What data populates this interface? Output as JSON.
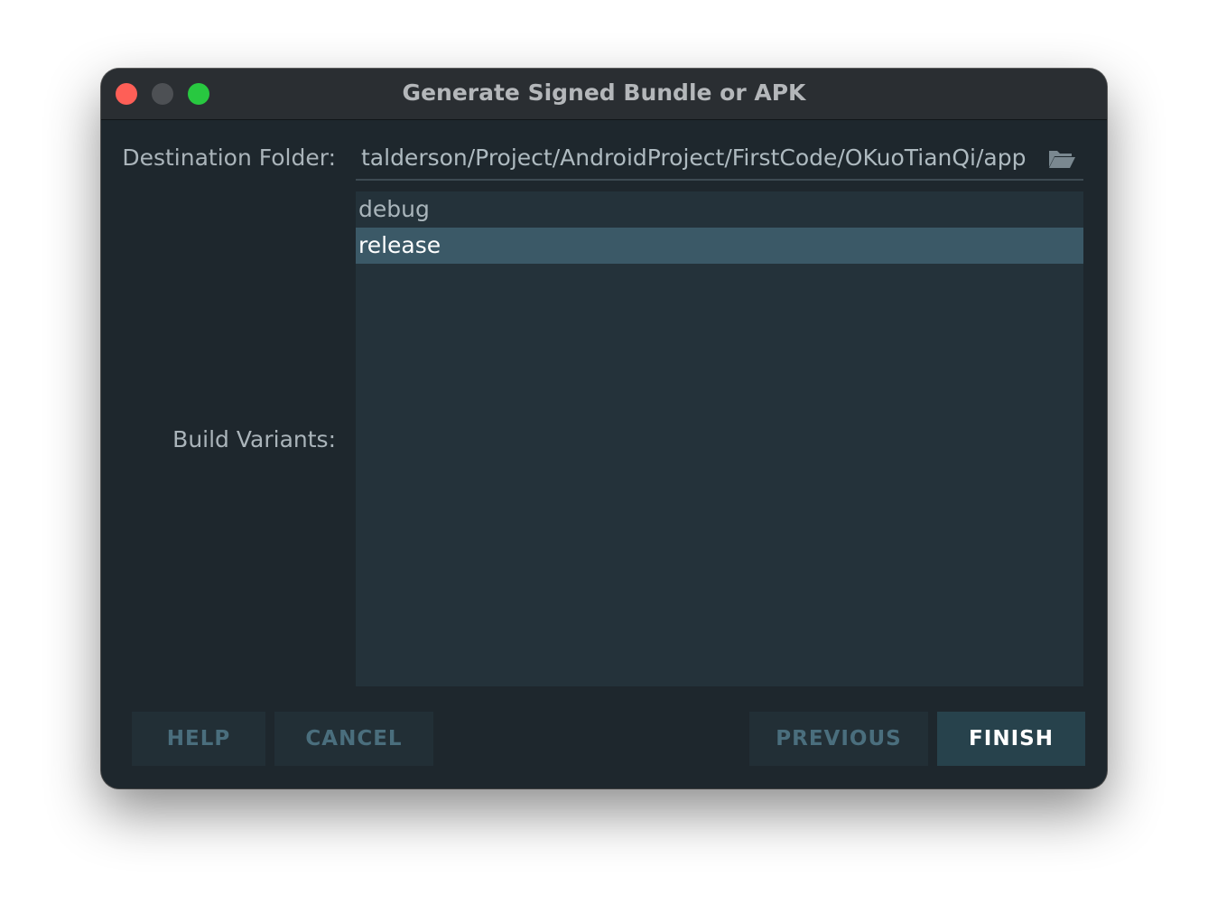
{
  "window": {
    "title": "Generate Signed Bundle or APK"
  },
  "form": {
    "destination_label": "Destination Folder:",
    "destination_value": "talderson/Project/AndroidProject/FirstCode/OKuoTianQi/app",
    "variants_label": "Build Variants:",
    "variants": [
      {
        "label": "debug",
        "selected": false
      },
      {
        "label": "release",
        "selected": true
      }
    ]
  },
  "buttons": {
    "help": "HELP",
    "cancel": "CANCEL",
    "previous": "PREVIOUS",
    "finish": "FINISH"
  },
  "icons": {
    "folder": "folder-open-icon"
  },
  "colors": {
    "close": "#fe5f57",
    "minimize": "#4d5054",
    "zoom": "#28c840",
    "selection": "#3b5967",
    "background": "#1e272d"
  }
}
